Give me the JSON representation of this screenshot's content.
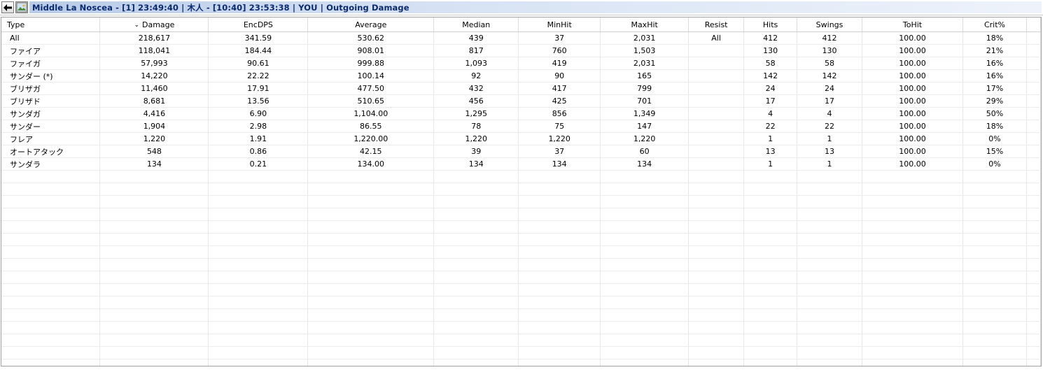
{
  "titlebar": {
    "back_icon": "arrow-left-icon",
    "image_icon": "image-icon",
    "title": "Middle La Noscea - [1] 23:49:40 | 木人 - [10:40] 23:53:38 | YOU | Outgoing Damage"
  },
  "columns": [
    "Type",
    "Damage",
    "EncDPS",
    "Average",
    "Median",
    "MinHit",
    "MaxHit",
    "Resist",
    "Hits",
    "Swings",
    "ToHit",
    "Crit%"
  ],
  "sort": {
    "column": "Damage",
    "direction": "descending",
    "icon": "chevron-down-icon"
  },
  "rows": [
    [
      "All",
      "218,617",
      "341.59",
      "530.62",
      "439",
      "37",
      "2,031",
      "All",
      "412",
      "412",
      "100.00",
      "18%"
    ],
    [
      "ファイア",
      "118,041",
      "184.44",
      "908.01",
      "817",
      "760",
      "1,503",
      "",
      "130",
      "130",
      "100.00",
      "21%"
    ],
    [
      "ファイガ",
      "57,993",
      "90.61",
      "999.88",
      "1,093",
      "419",
      "2,031",
      "",
      "58",
      "58",
      "100.00",
      "16%"
    ],
    [
      "サンダー (*)",
      "14,220",
      "22.22",
      "100.14",
      "92",
      "90",
      "165",
      "",
      "142",
      "142",
      "100.00",
      "16%"
    ],
    [
      "ブリザガ",
      "11,460",
      "17.91",
      "477.50",
      "432",
      "417",
      "799",
      "",
      "24",
      "24",
      "100.00",
      "17%"
    ],
    [
      "ブリザド",
      "8,681",
      "13.56",
      "510.65",
      "456",
      "425",
      "701",
      "",
      "17",
      "17",
      "100.00",
      "29%"
    ],
    [
      "サンダガ",
      "4,416",
      "6.90",
      "1,104.00",
      "1,295",
      "856",
      "1,349",
      "",
      "4",
      "4",
      "100.00",
      "50%"
    ],
    [
      "サンダー",
      "1,904",
      "2.98",
      "86.55",
      "78",
      "75",
      "147",
      "",
      "22",
      "22",
      "100.00",
      "18%"
    ],
    [
      "フレア",
      "1,220",
      "1.91",
      "1,220.00",
      "1,220",
      "1,220",
      "1,220",
      "",
      "1",
      "1",
      "100.00",
      "0%"
    ],
    [
      "オートアタック",
      "548",
      "0.86",
      "42.15",
      "39",
      "37",
      "60",
      "",
      "13",
      "13",
      "100.00",
      "15%"
    ],
    [
      "サンダラ",
      "134",
      "0.21",
      "134.00",
      "134",
      "134",
      "134",
      "",
      "1",
      "1",
      "100.00",
      "0%"
    ]
  ],
  "colors": {
    "title_text": "#0a2a6e",
    "title_bg_start": "#b9cbe7",
    "grid_line": "#e6e6e6"
  }
}
